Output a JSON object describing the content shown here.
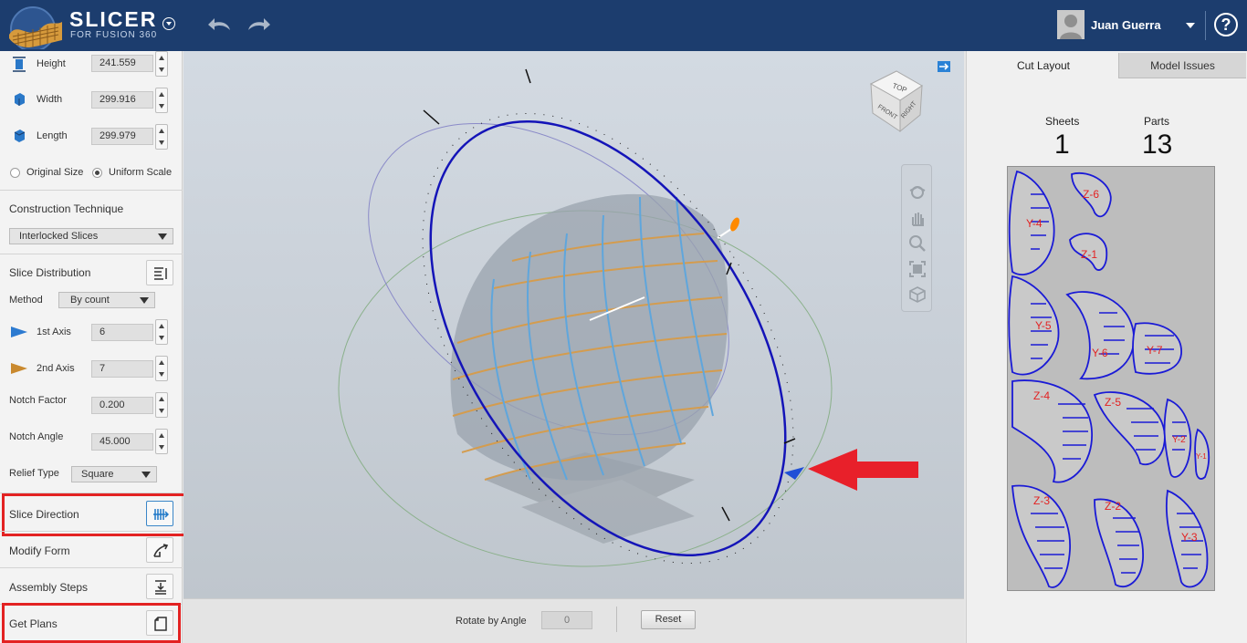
{
  "app": {
    "title": "SLICER",
    "subtitle": "FOR FUSION 360",
    "user_name": "Juan Guerra",
    "help_label": "?"
  },
  "dimensions": {
    "height_label": "Height",
    "height_value": "241.559",
    "width_label": "Width",
    "width_value": "299.916",
    "length_label": "Length",
    "length_value": "299.979",
    "original_size_label": "Original Size",
    "uniform_scale_label": "Uniform Scale",
    "selected_scale": "Uniform Scale"
  },
  "construction": {
    "title": "Construction Technique",
    "selected": "Interlocked Slices"
  },
  "distribution": {
    "title": "Slice Distribution",
    "method_label": "Method",
    "method_value": "By count",
    "axis1_label": "1st Axis",
    "axis1_value": "6",
    "axis2_label": "2nd Axis",
    "axis2_value": "7",
    "notch_factor_label": "Notch Factor",
    "notch_factor_value": "0.200",
    "notch_angle_label": "Notch Angle",
    "notch_angle_value": "45.000",
    "relief_label": "Relief Type",
    "relief_value": "Square"
  },
  "steps": {
    "slice_direction": "Slice Direction",
    "modify_form": "Modify Form",
    "assembly_steps": "Assembly Steps",
    "get_plans": "Get Plans"
  },
  "viewcube": {
    "top": "TOP",
    "front": "FRONT",
    "right": "RIGHT"
  },
  "bottom_bar": {
    "rotate_label": "Rotate by  Angle",
    "rotate_value": "0",
    "reset_label": "Reset"
  },
  "right_panel": {
    "tabs": [
      "Cut Layout",
      "Model Issues"
    ],
    "active_tab": "Cut Layout",
    "sheets_label": "Sheets",
    "sheets_value": "1",
    "parts_label": "Parts",
    "parts_value": "13",
    "part_labels": [
      "Y-4",
      "Z-6",
      "Z-1",
      "Y-5",
      "Y-6",
      "Y-7",
      "Z-4",
      "Z-5",
      "Y-2",
      "Y-1",
      "Z-3",
      "Z-2",
      "Y-3"
    ]
  },
  "colors": {
    "header": "#1c3d6e",
    "highlight": "#e32222",
    "part_outline": "#1a1ad6",
    "ring": "#1414b8",
    "slice_edge": "#d49c4e"
  }
}
